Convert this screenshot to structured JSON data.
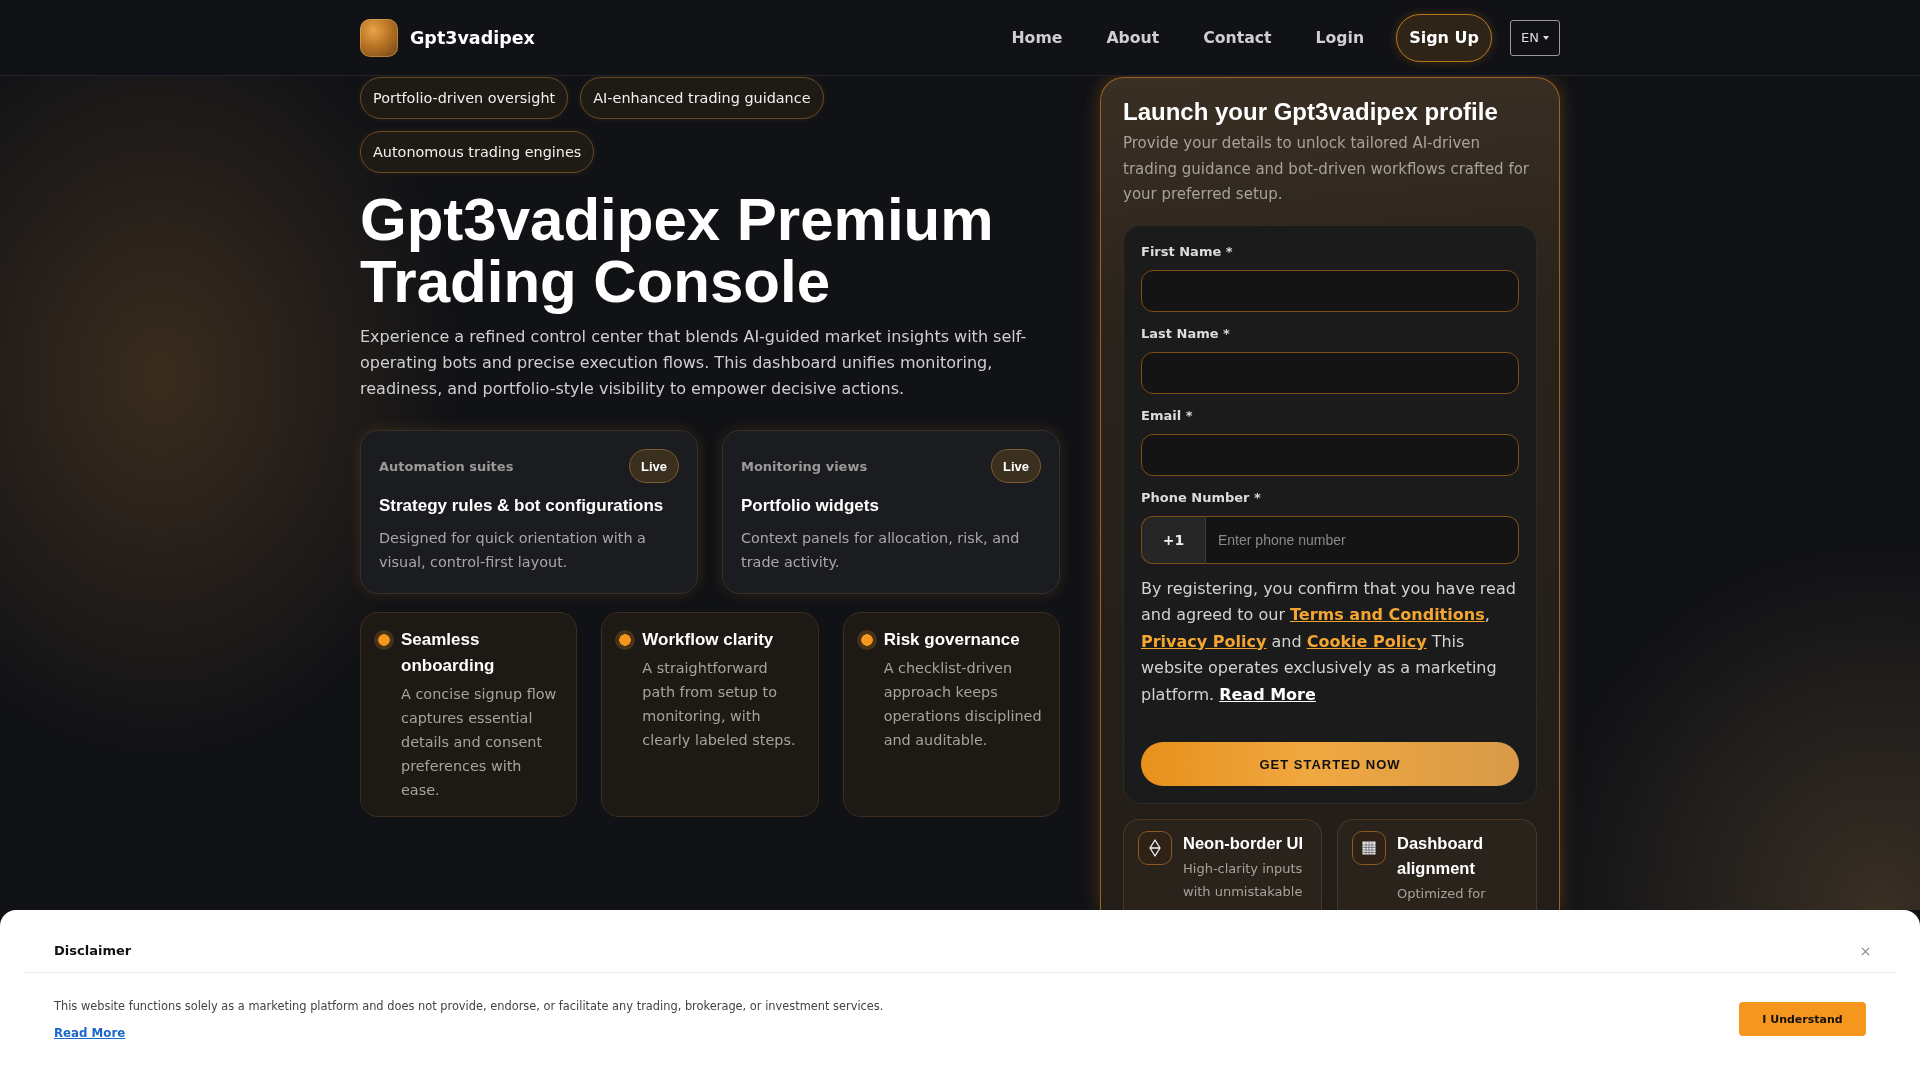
{
  "header": {
    "brand": "Gpt3vadipex",
    "nav": [
      {
        "label": "Home"
      },
      {
        "label": "About"
      },
      {
        "label": "Contact"
      },
      {
        "label": "Login"
      }
    ],
    "signup_button": "Sign Up",
    "language": "EN"
  },
  "tags": [
    "Portfolio-driven oversight",
    "AI-enhanced trading guidance",
    "Autonomous trading engines"
  ],
  "hero": {
    "title": "Gpt3vadipex Premium Trading Console",
    "description": "Experience a refined control center that blends AI-guided market insights with self-operating bots and precise execution flows. This dashboard unifies monitoring, readiness, and portfolio-style visibility to empower decisive actions."
  },
  "module_cards": [
    {
      "label": "Automation suites",
      "badge": "Live",
      "title": "Strategy rules & bot configurations",
      "description": "Designed for quick orientation with a visual, control-first layout."
    },
    {
      "label": "Monitoring views",
      "badge": "Live",
      "title": "Portfolio widgets",
      "description": "Context panels for allocation, risk, and trade activity."
    }
  ],
  "highlights": [
    {
      "title": "Seamless onboarding",
      "description": "A concise signup flow captures essential details and consent preferences with ease."
    },
    {
      "title": "Workflow clarity",
      "description": "A straightforward path from setup to monitoring, with clearly labeled steps."
    },
    {
      "title": "Risk governance",
      "description": "A checklist-driven approach keeps operations disciplined and auditable."
    }
  ],
  "signup": {
    "title": "Launch your Gpt3vadipex profile",
    "description": "Provide your details to unlock tailored AI-driven trading guidance and bot-driven workflows crafted for your preferred setup.",
    "fields": [
      {
        "kind": "text",
        "label": "First Name *"
      },
      {
        "kind": "text",
        "label": "Last Name *"
      },
      {
        "kind": "text",
        "label": "Email *"
      },
      {
        "kind": "phone",
        "label": "Phone Number *",
        "prefix": "+1",
        "placeholder": "Enter phone number"
      }
    ],
    "consent": [
      {
        "kind": "text",
        "text": "By registering, you confirm that you have read and agreed to our "
      },
      {
        "kind": "link",
        "text": "Terms and Conditions"
      },
      {
        "kind": "text",
        "text": ", "
      },
      {
        "kind": "link",
        "text": "Privacy Policy"
      },
      {
        "kind": "text",
        "text": " and "
      },
      {
        "kind": "link",
        "text": "Cookie Policy"
      },
      {
        "kind": "text",
        "text": " This website operates exclusively as a marketing platform. "
      },
      {
        "kind": "more",
        "text": "Read More"
      }
    ],
    "submit": "GET STARTED NOW"
  },
  "features": [
    {
      "title": "Neon-border UI",
      "description": "High-clarity inputs with unmistakable"
    },
    {
      "title": "Dashboard alignment",
      "description": "Optimized for"
    }
  ],
  "disclaimer": {
    "title": "Disclaimer",
    "text": "This website functions solely as a marketing platform and does not provide, endorse, or facilitate any trading, brokerage, or investment services.",
    "link": "Read More",
    "button": "I Understand"
  }
}
